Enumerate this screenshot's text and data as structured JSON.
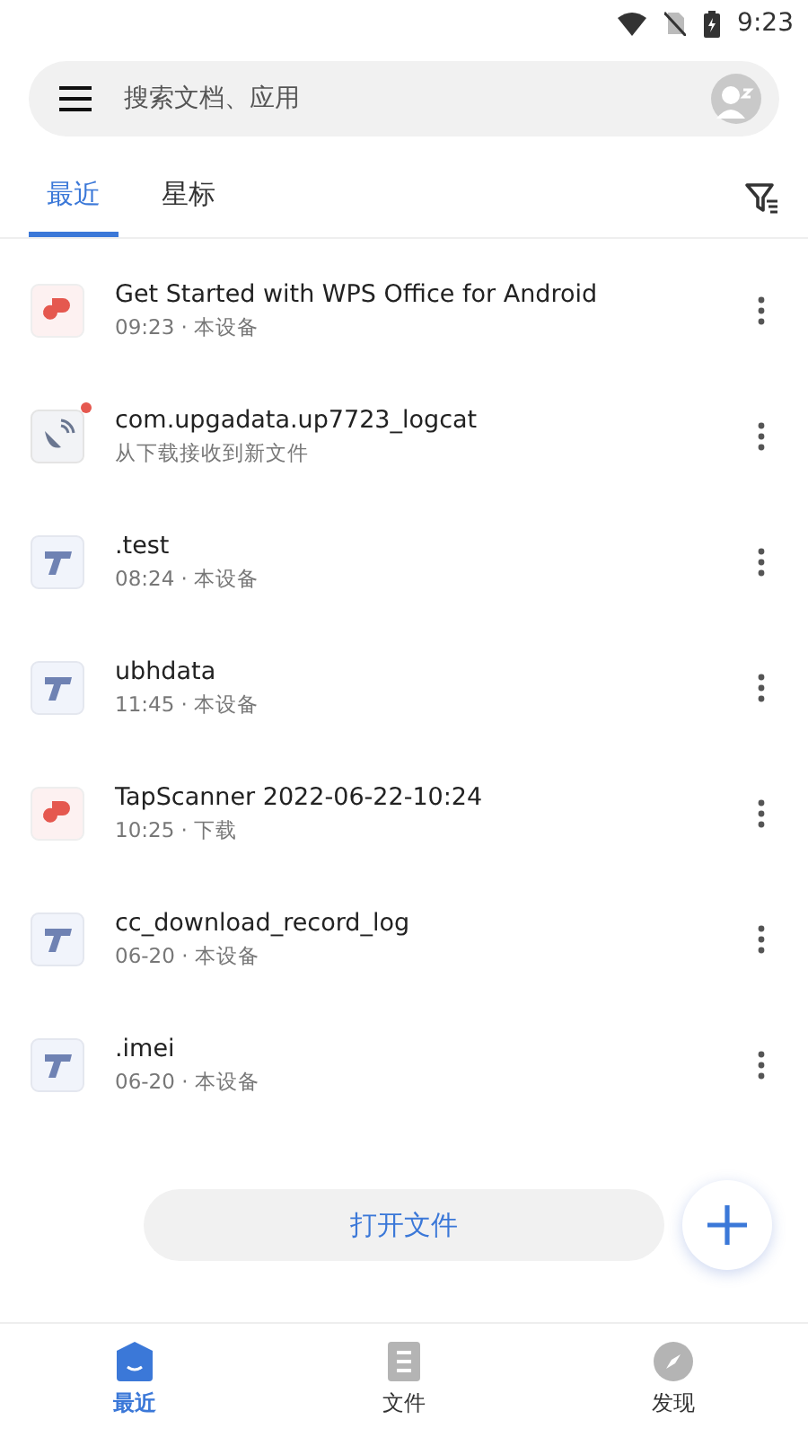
{
  "status_bar": {
    "time": "9:23"
  },
  "search": {
    "placeholder": "搜索文档、应用"
  },
  "tabs": [
    {
      "label": "最近",
      "selected": true
    },
    {
      "label": "星标",
      "selected": false
    }
  ],
  "files": [
    {
      "kind": "pdf",
      "name": "Get Started with WPS Office for Android",
      "meta": "09:23 · 本设备",
      "unread": false
    },
    {
      "kind": "download",
      "name": "com.upgadata.up7723_logcat",
      "meta": "从下载接收到新文件",
      "unread": true
    },
    {
      "kind": "text",
      "name": ".test",
      "meta": "08:24 · 本设备",
      "unread": false
    },
    {
      "kind": "text",
      "name": "ubhdata",
      "meta": "11:45 · 本设备",
      "unread": false
    },
    {
      "kind": "pdf",
      "name": "TapScanner 2022-06-22-10:24",
      "meta": "10:25 · 下载",
      "unread": false
    },
    {
      "kind": "text",
      "name": "cc_download_record_log",
      "meta": "06-20 · 本设备",
      "unread": false
    },
    {
      "kind": "text",
      "name": ".imei",
      "meta": "06-20 · 本设备",
      "unread": false
    }
  ],
  "open_button": "打开文件",
  "nav": [
    {
      "kind": "recent",
      "label": "最近",
      "selected": true
    },
    {
      "kind": "files",
      "label": "文件",
      "selected": false
    },
    {
      "kind": "discover",
      "label": "发现",
      "selected": false
    }
  ]
}
